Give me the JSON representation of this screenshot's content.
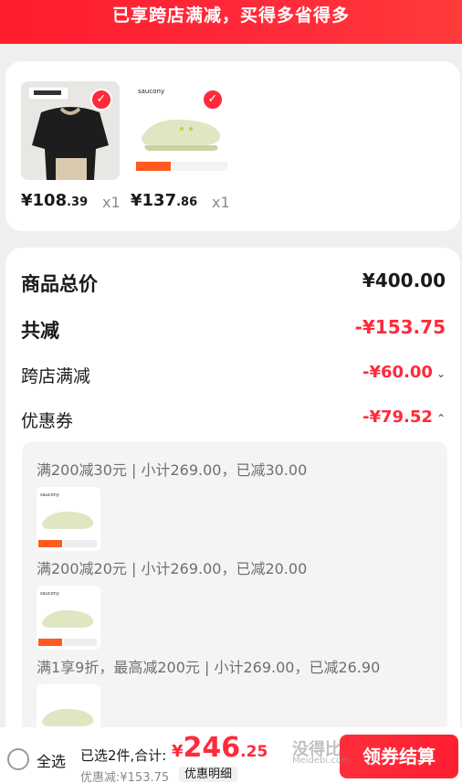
{
  "banner": {
    "text": "已享跨店满减，买得多省得多"
  },
  "products": [
    {
      "name": "black-tshirt",
      "price_main": "¥108",
      "price_cents": ".39",
      "qty": "x1",
      "brand": ""
    },
    {
      "name": "saucony-slide",
      "price_main": "¥137",
      "price_cents": ".86",
      "qty": "x1",
      "brand": "saucony"
    }
  ],
  "summary": {
    "total_label": "商品总价",
    "total_value": "¥400.00",
    "reduce_label": "共减",
    "reduce_value": "-¥153.75",
    "crossstore_label": "跨店满减",
    "crossstore_value": "-¥60.00",
    "coupon_label": "优惠券",
    "coupon_value": "-¥79.52"
  },
  "coupons": [
    {
      "text": "满200减30元 | 小计269.00，已减30.00"
    },
    {
      "text": "满200减20元 | 小计269.00，已减20.00"
    },
    {
      "text": "满1享9折，最高减200元 | 小计269.00，已减26.90"
    }
  ],
  "bottom": {
    "select_all": "全选",
    "picked": "已选2件,合计:",
    "total_symbol": "¥",
    "total_main": "246",
    "total_cents": ".25",
    "discount": "优惠减:¥153.75",
    "detail": "优惠明细",
    "checkout": "领券结算"
  },
  "watermark": {
    "main": "没得比",
    "sub": "Meidebi.com"
  },
  "colors": {
    "accent": "#ff2a3a",
    "banner": "#ff1d2d"
  }
}
